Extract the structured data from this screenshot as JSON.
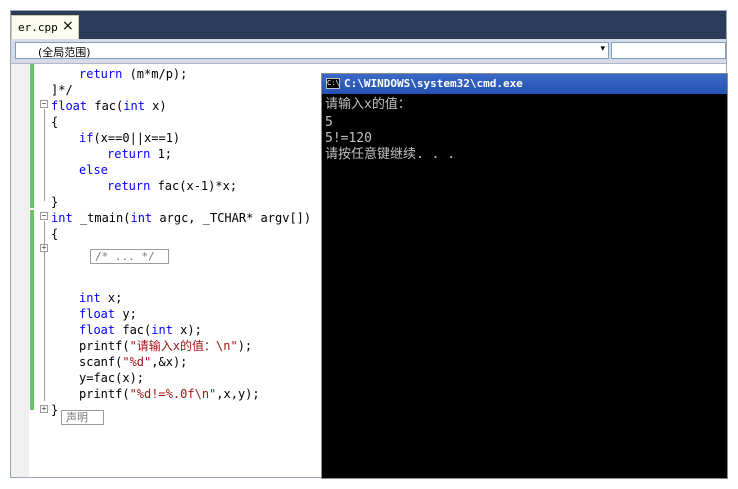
{
  "tabs": [
    {
      "label": "er.cpp",
      "close_glyph": "×"
    }
  ],
  "nav": {
    "scope_label": "(全局范围)",
    "arrow": "▾",
    "member_label": ""
  },
  "code": [
    {
      "indent": 1,
      "tokens": [
        [
          "kw",
          "return"
        ],
        [
          "t",
          " (m*m/p);"
        ]
      ]
    },
    {
      "indent": 0,
      "tokens": [
        [
          "t",
          "]*/"
        ]
      ]
    },
    {
      "indent": 0,
      "tokens": [
        [
          "kw",
          "float"
        ],
        [
          "t",
          " fac("
        ],
        [
          "kw",
          "int"
        ],
        [
          "t",
          " x)"
        ]
      ]
    },
    {
      "indent": 0,
      "tokens": [
        [
          "t",
          "{"
        ]
      ]
    },
    {
      "indent": 1,
      "tokens": [
        [
          "kw",
          "if"
        ],
        [
          "t",
          "(x==0||x==1)"
        ]
      ]
    },
    {
      "indent": 2,
      "tokens": [
        [
          "kw",
          "return"
        ],
        [
          "t",
          " 1;"
        ]
      ]
    },
    {
      "indent": 1,
      "tokens": [
        [
          "kw",
          "else"
        ]
      ]
    },
    {
      "indent": 2,
      "tokens": [
        [
          "kw",
          "return"
        ],
        [
          "t",
          " fac(x-1)*x;"
        ]
      ]
    },
    {
      "indent": 0,
      "tokens": [
        [
          "t",
          "}"
        ]
      ]
    },
    {
      "indent": 0,
      "tokens": [
        [
          "kw",
          "int"
        ],
        [
          "t",
          " _tmain("
        ],
        [
          "kw",
          "int"
        ],
        [
          "t",
          " argc, _TCHAR* argv[])"
        ]
      ]
    },
    {
      "indent": 0,
      "tokens": [
        [
          "t",
          "{"
        ]
      ]
    },
    {
      "indent": 1,
      "tokens": []
    },
    {
      "indent": 0,
      "tokens": []
    },
    {
      "indent": 0,
      "tokens": []
    },
    {
      "indent": 1,
      "tokens": [
        [
          "kw",
          "int"
        ],
        [
          "t",
          " x;"
        ]
      ]
    },
    {
      "indent": 1,
      "tokens": [
        [
          "kw",
          "float"
        ],
        [
          "t",
          " y;"
        ]
      ]
    },
    {
      "indent": 1,
      "tokens": [
        [
          "kw",
          "float"
        ],
        [
          "t",
          " fac("
        ],
        [
          "kw",
          "int"
        ],
        [
          "t",
          " x);"
        ]
      ]
    },
    {
      "indent": 1,
      "tokens": [
        [
          "t",
          "printf("
        ],
        [
          "str",
          "\"请输入x的值：\\n\""
        ],
        [
          "t",
          ");"
        ]
      ]
    },
    {
      "indent": 1,
      "tokens": [
        [
          "t",
          "scanf("
        ],
        [
          "str",
          "\"%d\""
        ],
        [
          "t",
          ",&x);"
        ]
      ]
    },
    {
      "indent": 1,
      "tokens": [
        [
          "t",
          "y=fac(x);"
        ]
      ]
    },
    {
      "indent": 1,
      "tokens": [
        [
          "t",
          "printf("
        ],
        [
          "str",
          "\"%d!=%.0f\\n\""
        ],
        [
          "t",
          ",x,y);"
        ]
      ]
    },
    {
      "indent": 0,
      "tokens": [
        [
          "t",
          "}"
        ]
      ]
    }
  ],
  "collapsed_block": "/* ... */",
  "collapsed_declaration": "声明",
  "console": {
    "title": "C:\\WINDOWS\\system32\\cmd.exe",
    "icon_text": "C:\\",
    "lines": [
      "请输入x的值：",
      "5",
      "5!=120",
      "请按任意键继续. . ."
    ]
  },
  "colors": {
    "keyword": "#0000ff",
    "string": "#a31515",
    "tab_strip": "#2b3c59",
    "cmd_title": "#2552b2",
    "change_bar": "#6ac36a"
  }
}
